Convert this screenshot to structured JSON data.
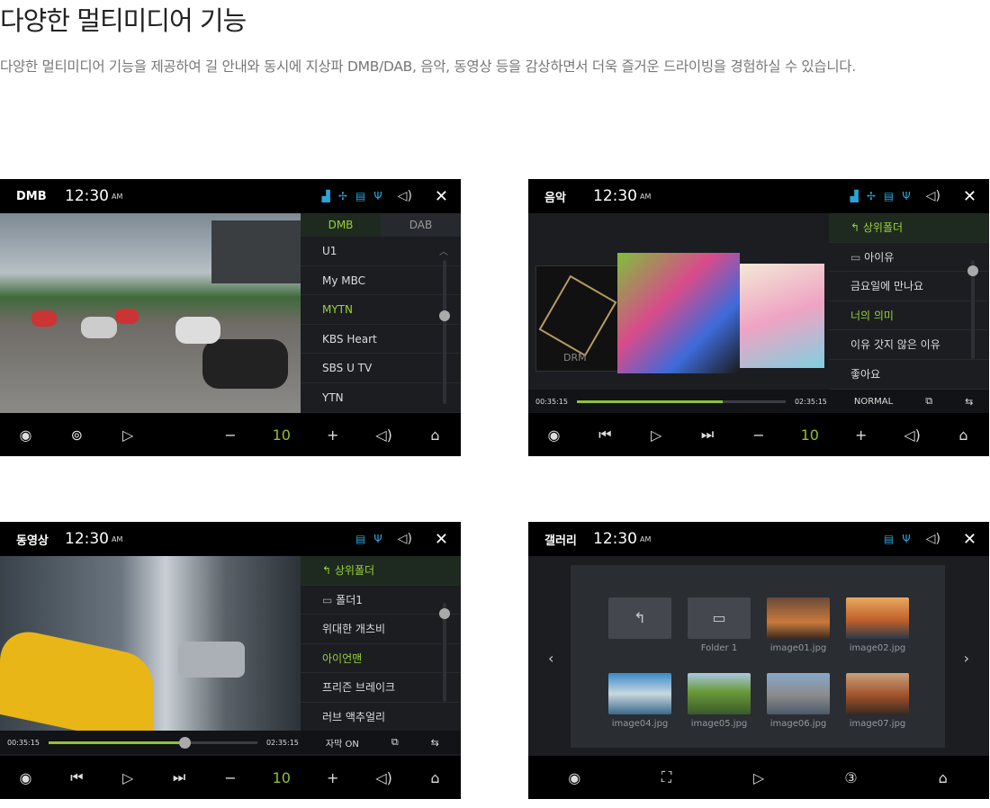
{
  "page": {
    "heading": "다양한 멀티미디어 기능",
    "description": "다양한 멀티미디어 기능을 제공하여 길 안내와 동시에 지상파 DMB/DAB, 음악, 동영상 등을 감상하면서 더욱 즐거운 드라이빙을 경험하실 수 있습니다."
  },
  "clock": {
    "time": "12:30",
    "ampm": "AM"
  },
  "dmb": {
    "title": "DMB",
    "tabs": [
      "DMB",
      "DAB"
    ],
    "channels": [
      "U1",
      "My MBC",
      "MYTN",
      "KBS Heart",
      "SBS U TV",
      "YTN"
    ],
    "selected": "MYTN",
    "volume": "10"
  },
  "music": {
    "title": "음악",
    "up": "상위폴더",
    "folder": "아이유",
    "songs": [
      "금요일에 만나요",
      "너의 의미",
      "이유 갓지 않은 이유",
      "좋아요"
    ],
    "selected": "너의 의미",
    "elapsed": "00:35:15",
    "total": "02:35:15",
    "progress": 0.7,
    "mode": "NORMAL",
    "volume": "10",
    "drm": "DRM"
  },
  "video": {
    "title": "동영상",
    "up": "상위폴더",
    "folder": "폴더1",
    "items": [
      "위대한 개츠비",
      "아이언맨",
      "프리즌 브레이크",
      "러브 액추얼리"
    ],
    "selected": "아이언맨",
    "elapsed": "00:35:15",
    "total": "02:35:15",
    "progress": 0.65,
    "subtitle": "자막 ON",
    "volume": "10"
  },
  "gallery": {
    "title": "갤러리",
    "folder": "Folder 1",
    "images": [
      "image01.jpg",
      "image02.jpg",
      "image04.jpg",
      "image05.jpg",
      "image06.jpg",
      "image07.jpg"
    ]
  }
}
